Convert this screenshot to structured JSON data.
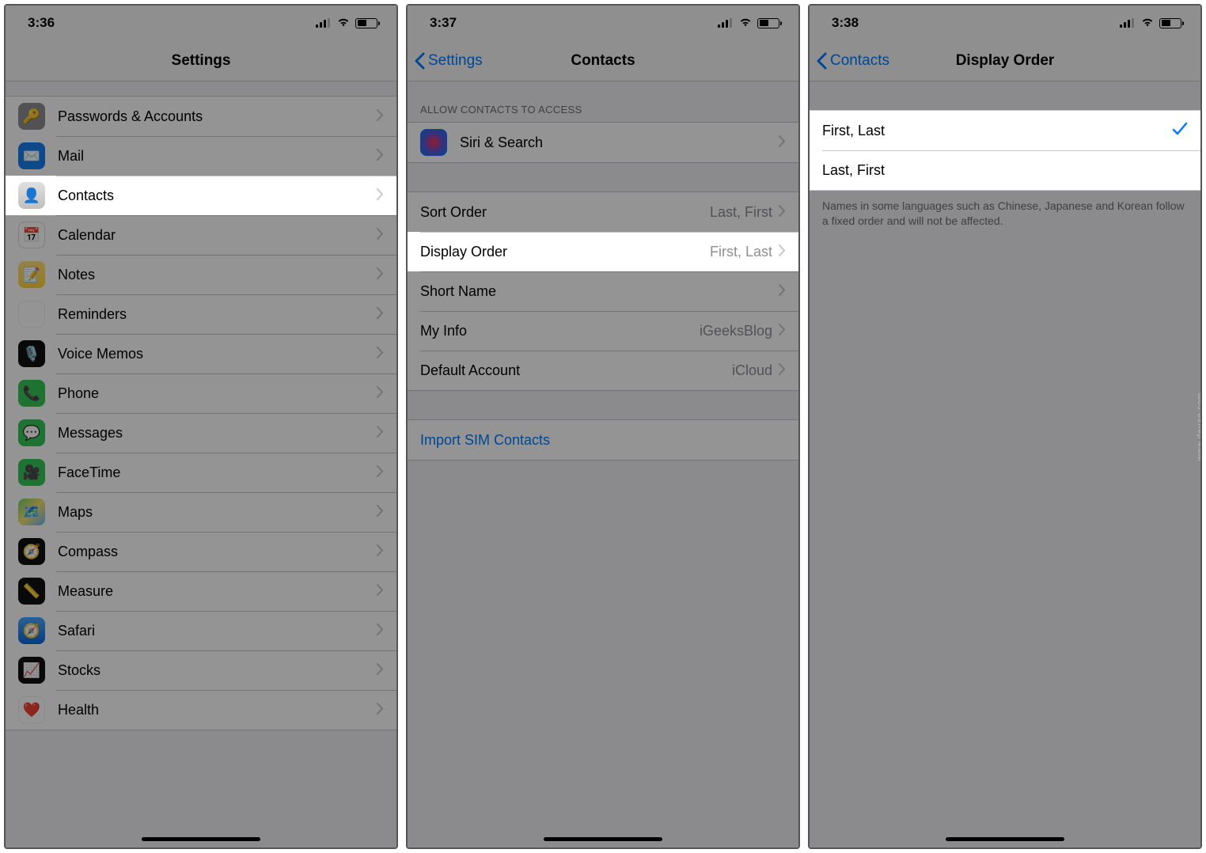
{
  "watermark": "www.deuaq.com",
  "screen1": {
    "time": "3:36",
    "title": "Settings",
    "rows": [
      {
        "label": "Passwords & Accounts",
        "icon": "key"
      },
      {
        "label": "Mail",
        "icon": "mail"
      },
      {
        "label": "Contacts",
        "icon": "contacts",
        "highlight": true
      },
      {
        "label": "Calendar",
        "icon": "calendar"
      },
      {
        "label": "Notes",
        "icon": "notes"
      },
      {
        "label": "Reminders",
        "icon": "reminders"
      },
      {
        "label": "Voice Memos",
        "icon": "voicememos"
      },
      {
        "label": "Phone",
        "icon": "phone"
      },
      {
        "label": "Messages",
        "icon": "messages"
      },
      {
        "label": "FaceTime",
        "icon": "facetime"
      },
      {
        "label": "Maps",
        "icon": "maps"
      },
      {
        "label": "Compass",
        "icon": "compass"
      },
      {
        "label": "Measure",
        "icon": "measure"
      },
      {
        "label": "Safari",
        "icon": "safari"
      },
      {
        "label": "Stocks",
        "icon": "stocks"
      },
      {
        "label": "Health",
        "icon": "health"
      }
    ]
  },
  "screen2": {
    "time": "3:37",
    "back": "Settings",
    "title": "Contacts",
    "section_header": "ALLOW CONTACTS TO ACCESS",
    "siri_row": {
      "label": "Siri & Search"
    },
    "rows2": [
      {
        "label": "Sort Order",
        "value": "Last, First"
      },
      {
        "label": "Display Order",
        "value": "First, Last",
        "highlight": true
      },
      {
        "label": "Short Name",
        "value": ""
      },
      {
        "label": "My Info",
        "value": "iGeeksBlog"
      },
      {
        "label": "Default Account",
        "value": "iCloud"
      }
    ],
    "import_label": "Import SIM Contacts"
  },
  "screen3": {
    "time": "3:38",
    "back": "Contacts",
    "title": "Display Order",
    "options": [
      {
        "label": "First, Last",
        "selected": true
      },
      {
        "label": "Last, First",
        "selected": false
      }
    ],
    "footer": "Names in some languages such as Chinese, Japanese and Korean follow a fixed order and will not be affected."
  }
}
